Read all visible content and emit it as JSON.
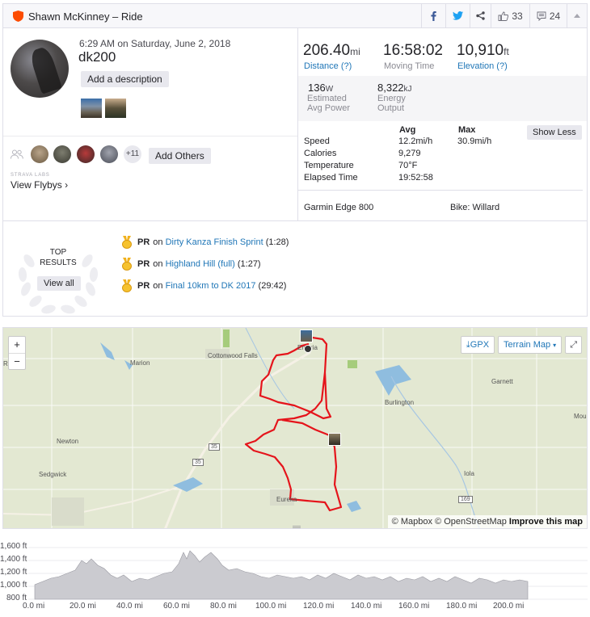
{
  "header": {
    "title": "Shawn McKinney – Ride",
    "kudos_count": "33",
    "comment_count": "24"
  },
  "activity": {
    "date": "6:29 AM on Saturday, June 2, 2018",
    "name": "dk200",
    "add_description": "Add a description"
  },
  "social": {
    "more_count": "+11",
    "add_others": "Add Others",
    "labs_label": "STRAVA LABS",
    "flybys_label": "View Flybys ›"
  },
  "stats": {
    "distance": {
      "value": "206.40",
      "unit": "mi",
      "label": "Distance (?)"
    },
    "moving_time": {
      "value": "16:58:02",
      "label": "Moving Time"
    },
    "elevation": {
      "value": "10,910",
      "unit": "ft",
      "label": "Elevation (?)"
    },
    "power": {
      "value": "136",
      "unit": "W",
      "label1": "Estimated",
      "label2": "Avg Power"
    },
    "energy": {
      "value": "8,322",
      "unit": "kJ",
      "label1": "Energy",
      "label2": "Output"
    },
    "table": {
      "avg_header": "Avg",
      "max_header": "Max",
      "show_less": "Show Less",
      "rows": [
        {
          "label": "Speed",
          "avg": "12.2mi/h",
          "max": "30.9mi/h"
        },
        {
          "label": "Calories",
          "avg": "9,279",
          "max": ""
        },
        {
          "label": "Temperature",
          "avg": "70°F",
          "max": ""
        },
        {
          "label": "Elapsed Time",
          "avg": "19:52:58",
          "max": ""
        }
      ]
    },
    "device": "Garmin Edge 800",
    "bike": "Bike: Willard"
  },
  "top_results": {
    "title_line1": "TOP",
    "title_line2": "RESULTS",
    "view_all": "View all",
    "items": [
      {
        "pr": "PR",
        "on": "on",
        "segment": "Dirty Kanza Finish Sprint",
        "time": "(1:28)"
      },
      {
        "pr": "PR",
        "on": "on",
        "segment": "Highland Hill (full)",
        "time": "(1:27)"
      },
      {
        "pr": "PR",
        "on": "on",
        "segment": "Final 10km to DK 2017",
        "time": "(29:42)"
      }
    ]
  },
  "map": {
    "zoom_in": "+",
    "zoom_out": "−",
    "gpx": "GPX",
    "map_type": "Terrain Map",
    "attribution_mapbox": "© Mapbox",
    "attribution_osm": "© OpenStreetMap",
    "improve": "Improve this map",
    "places": [
      "Ride",
      "Marion",
      "Cottonwood Falls",
      "Em",
      "ria",
      "Garnett",
      "Burlington",
      "Mour",
      "Newton",
      "Sedgwick",
      "Eureka",
      "Iola",
      "35",
      "35",
      "169"
    ]
  },
  "elevation": {
    "y_ticks": [
      "1,600 ft",
      "1,400 ft",
      "1,200 ft",
      "1,000 ft",
      "800 ft"
    ],
    "x_ticks": [
      "0.0 mi",
      "20.0 mi",
      "40.0 mi",
      "60.0 mi",
      "80.0 mi",
      "100.0 mi",
      "120.0 mi",
      "140.0 mi",
      "160.0 mi",
      "180.0 mi",
      "200.0 mi"
    ]
  },
  "colors": {
    "accent": "#fc4c02",
    "link": "#1f76b7",
    "route": "#e5141b"
  }
}
